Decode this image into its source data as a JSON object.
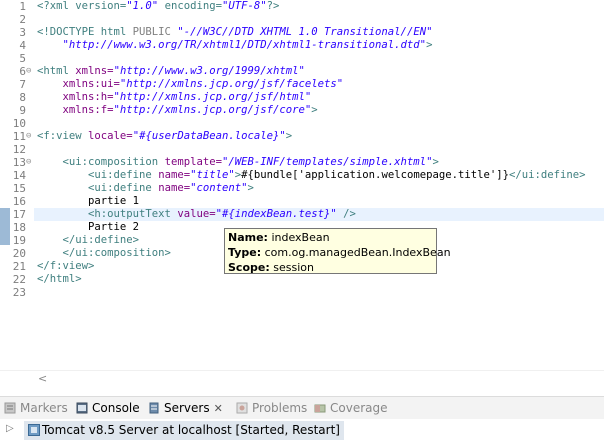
{
  "editor": {
    "line_numbers": [
      "1",
      "2",
      "3",
      "4",
      "5",
      "6",
      "7",
      "8",
      "9",
      "10",
      "11",
      "12",
      "13",
      "14",
      "15",
      "16",
      "17",
      "18",
      "19",
      "20",
      "21",
      "22",
      "23"
    ],
    "lines": [
      [
        {
          "c": "pi",
          "t": "<?xml version="
        },
        {
          "c": "av",
          "t": "\"1.0\""
        },
        {
          "c": "pi",
          "t": " encoding="
        },
        {
          "c": "av",
          "t": "\"UTF-8\""
        },
        {
          "c": "pi",
          "t": "?>"
        }
      ],
      [],
      [
        {
          "c": "dt",
          "t": "<!DOCTYPE html "
        },
        {
          "c": "dk",
          "t": "PUBLIC"
        },
        {
          "c": "av",
          "t": " \"-//W3C//DTD XHTML 1.0 Transitional//EN\""
        }
      ],
      [
        {
          "c": "av",
          "t": "    \"http://www.w3.org/TR/xhtml1/DTD/xhtml1-transitional.dtd\""
        },
        {
          "c": "dt",
          "t": ">"
        }
      ],
      [],
      [
        {
          "c": "tag",
          "t": "<html "
        },
        {
          "c": "an",
          "t": "xmlns="
        },
        {
          "c": "av",
          "t": "\"http://www.w3.org/1999/xhtml\""
        }
      ],
      [
        {
          "c": "an",
          "t": "    xmlns:ui="
        },
        {
          "c": "av",
          "t": "\"http://xmlns.jcp.org/jsf/facelets\""
        }
      ],
      [
        {
          "c": "an",
          "t": "    xmlns:h="
        },
        {
          "c": "av",
          "t": "\"http://xmlns.jcp.org/jsf/html\""
        }
      ],
      [
        {
          "c": "an",
          "t": "    xmlns:f="
        },
        {
          "c": "av",
          "t": "\"http://xmlns.jcp.org/jsf/core\""
        },
        {
          "c": "tag",
          "t": ">"
        }
      ],
      [],
      [
        {
          "c": "tag",
          "t": "<f:view "
        },
        {
          "c": "an",
          "t": "locale="
        },
        {
          "c": "av",
          "t": "\"#{userDataBean.locale}\""
        },
        {
          "c": "tag",
          "t": ">"
        }
      ],
      [],
      [
        {
          "c": "tag",
          "t": "    <ui:composition "
        },
        {
          "c": "an",
          "t": "template="
        },
        {
          "c": "av",
          "t": "\"/WEB-INF/templates/simple.xhtml\""
        },
        {
          "c": "tag",
          "t": ">"
        }
      ],
      [
        {
          "c": "tag",
          "t": "        <ui:define "
        },
        {
          "c": "an",
          "t": "name="
        },
        {
          "c": "av",
          "t": "\"title\""
        },
        {
          "c": "tag",
          "t": ">"
        },
        {
          "c": "",
          "t": "#{bundle['application.welcomepage.title']}"
        },
        {
          "c": "tag",
          "t": "</ui:define>"
        }
      ],
      [
        {
          "c": "tag",
          "t": "        <ui:define "
        },
        {
          "c": "an",
          "t": "name="
        },
        {
          "c": "av",
          "t": "\"content\""
        },
        {
          "c": "tag",
          "t": ">"
        }
      ],
      [
        {
          "c": "",
          "t": "        partie 1"
        }
      ],
      [
        {
          "c": "tag",
          "t": "        <h:outputText "
        },
        {
          "c": "an",
          "t": "value="
        },
        {
          "c": "av",
          "t": "\"#{indexBean.test}\""
        },
        {
          "c": "tag",
          "t": " />"
        }
      ],
      [
        {
          "c": "",
          "t": "        Partie 2"
        }
      ],
      [
        {
          "c": "tag",
          "t": "    </ui:define>"
        }
      ],
      [
        {
          "c": "tag",
          "t": "    </ui:composition>"
        }
      ],
      [
        {
          "c": "tag",
          "t": "</f:view>"
        }
      ],
      [
        {
          "c": "tag",
          "t": "</html>"
        }
      ],
      []
    ]
  },
  "tooltip": {
    "name_label": "Name:",
    "name_value": " indexBean",
    "type_label": "Type:",
    "type_value": " com.og.managedBean.IndexBean",
    "scope_label": "Scope:",
    "scope_value": " session"
  },
  "scroll": {
    "left_arrow": "<"
  },
  "tabs": {
    "markers": "Markers",
    "console": "Console",
    "servers": "Servers",
    "servers_close": "✕",
    "problems": "Problems",
    "coverage": "Coverage"
  },
  "servers": {
    "row_label": "Tomcat v8.5 Server at localhost  [Started, Restart]",
    "expand_glyph": "▷"
  }
}
